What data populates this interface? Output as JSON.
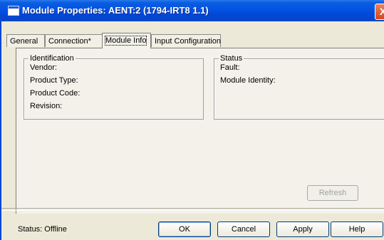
{
  "window": {
    "title": "Module Properties: AENT:2 (1794-IRT8 1.1)",
    "close_glyph": "X"
  },
  "tabs": [
    {
      "label": "General",
      "active": false
    },
    {
      "label": "Connection*",
      "active": false
    },
    {
      "label": "Module Info",
      "active": true
    },
    {
      "label": "Input Configuration",
      "active": false
    }
  ],
  "identification": {
    "title": "Identification",
    "vendor_label": "Vendor:",
    "product_type_label": "Product Type:",
    "product_code_label": "Product Code:",
    "revision_label": "Revision:"
  },
  "status_group": {
    "title": "Status",
    "fault_label": "Fault:",
    "module_identity_label": "Module Identity:"
  },
  "refresh_label": "Refresh",
  "footer": {
    "status_text": "Status:  Offline",
    "ok_label": "OK",
    "cancel_label": "Cancel",
    "apply_label": "Apply",
    "help_label": "Help"
  },
  "colors": {
    "titlebar": "#0554e3",
    "dialog_bg": "#ece9d8",
    "close_button": "#d4471d"
  }
}
